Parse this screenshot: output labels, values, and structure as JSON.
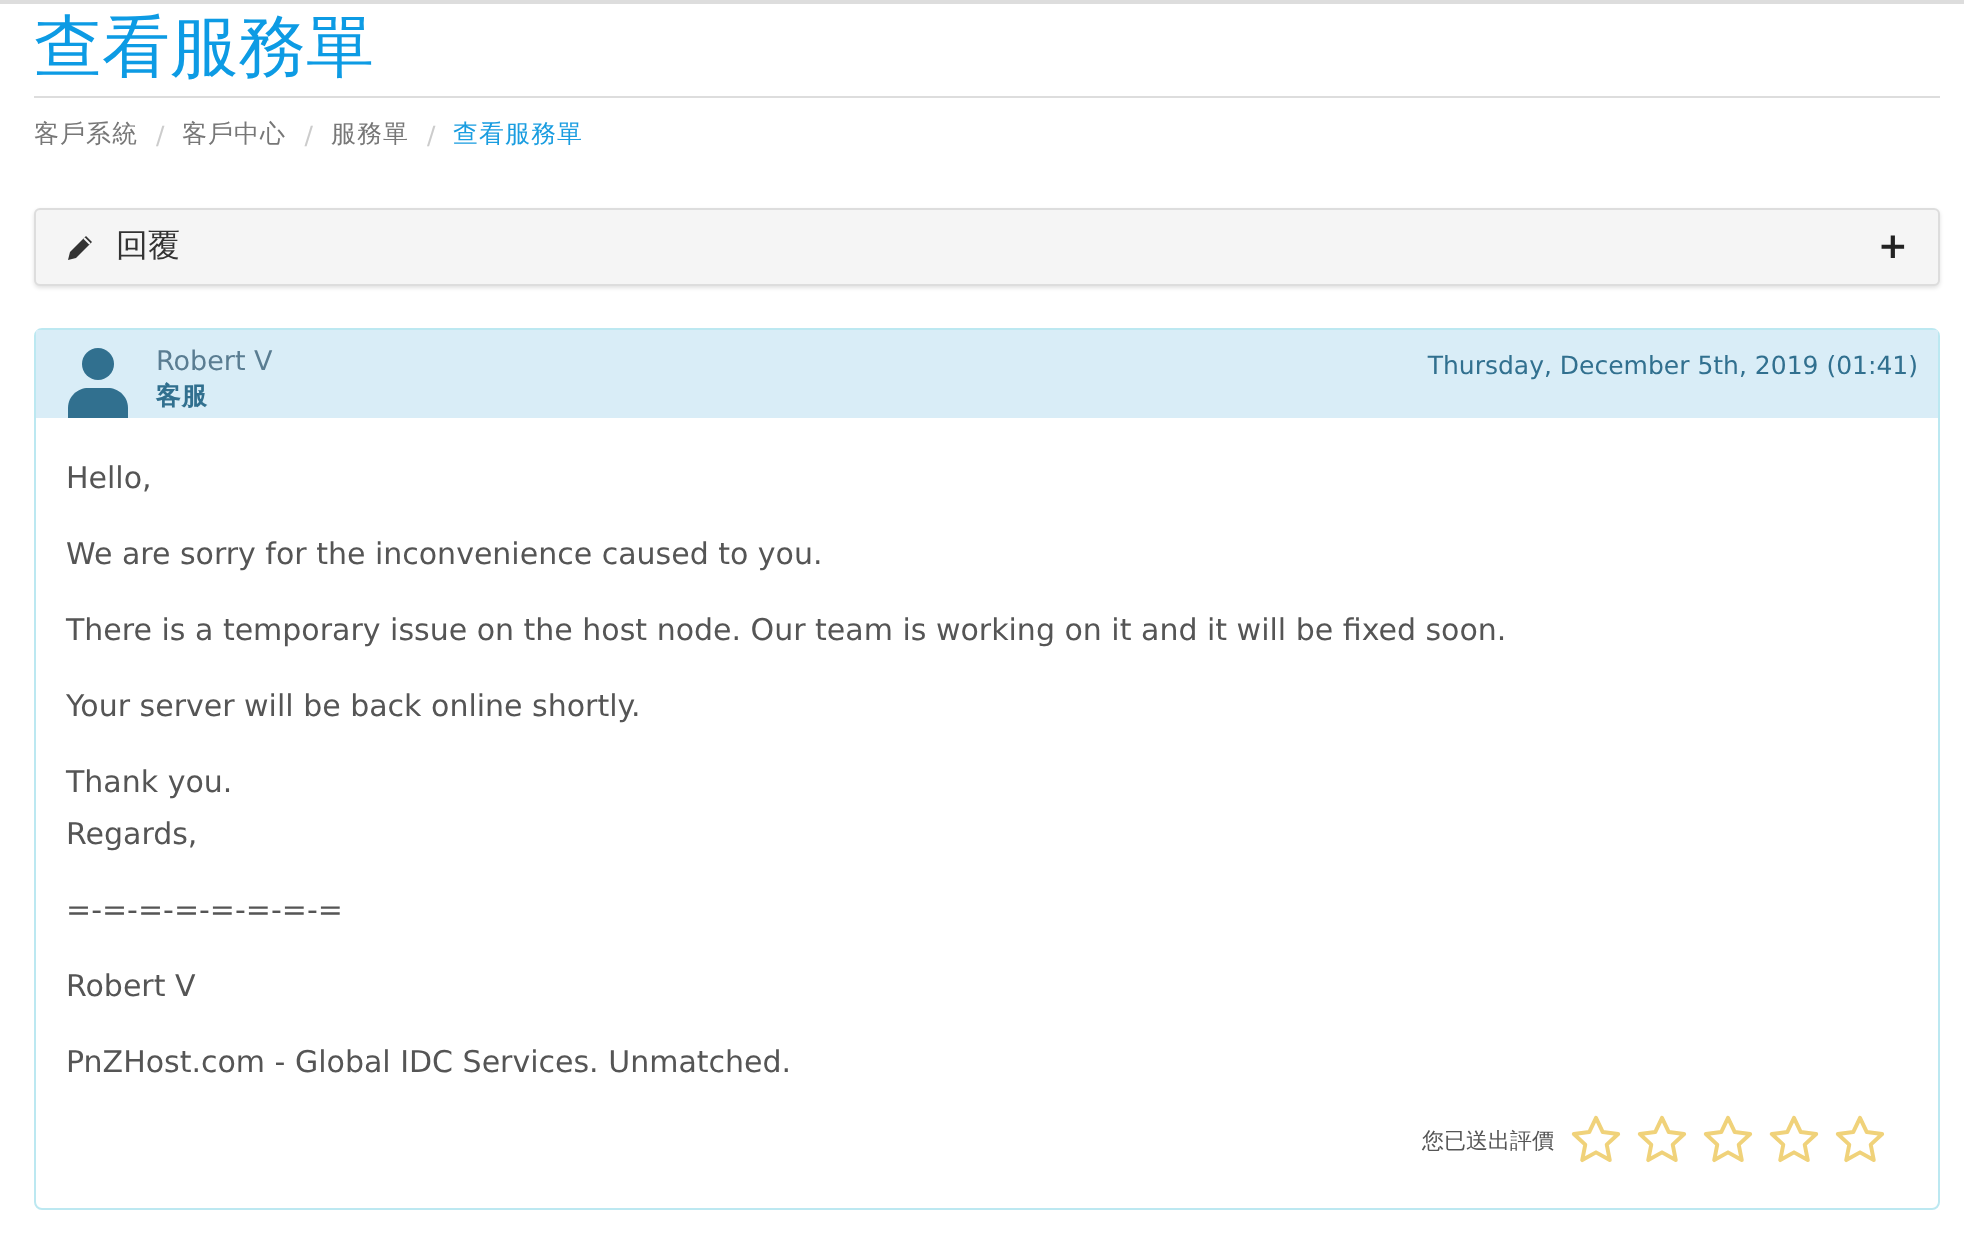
{
  "page_title": "查看服務單",
  "breadcrumb": [
    {
      "label": "客戶系統",
      "separator": "/",
      "selected": false
    },
    {
      "label": "客戶中心",
      "separator": "/",
      "selected": false
    },
    {
      "label": "服務單",
      "separator": "/",
      "selected": false
    },
    {
      "label": "查看服務單",
      "selected": true
    }
  ],
  "reply_panel": {
    "label": "回覆",
    "toggle": "+"
  },
  "message": {
    "author": "Robert V",
    "role": "客服",
    "date": "Thursday, December 5th, 2019 (01:41)",
    "paragraphs": [
      "Hello,",
      "We are sorry for the inconvenience caused to you.",
      "There is a temporary issue on the host node. Our team is working on it and it will be fixed soon.",
      "Your server will be back online shortly.",
      "Thank you.\nRegards,",
      "=-=-=-=-=-=-=-=",
      "Robert V",
      "PnZHost.com - Global IDC Services. Unmatched."
    ],
    "rating_label": "您已送出評價",
    "stars": 0
  }
}
